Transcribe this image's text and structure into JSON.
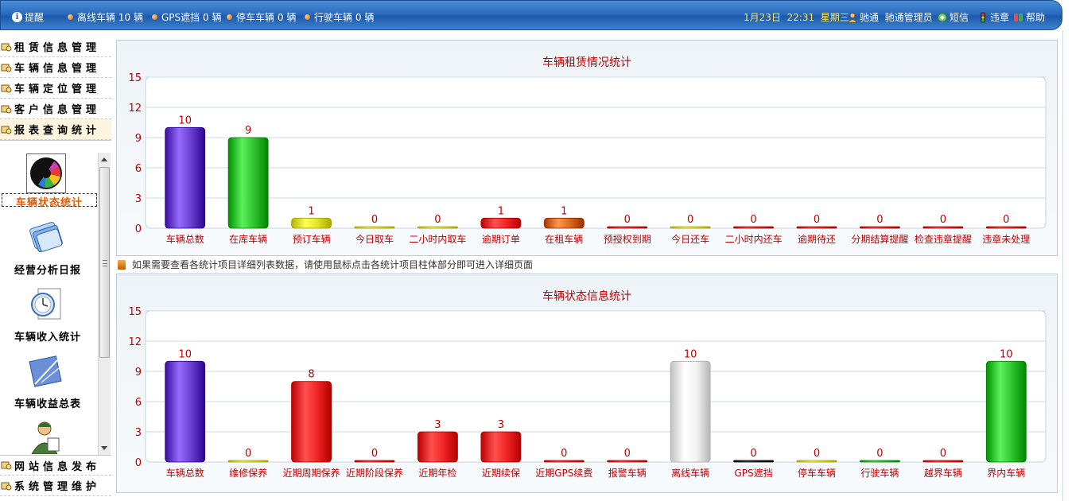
{
  "topbar": {
    "reminder": "提醒",
    "stats": [
      {
        "label": "离线车辆",
        "count": "10",
        "unit": "辆"
      },
      {
        "label": "GPS遮挡",
        "count": "0",
        "unit": "辆"
      },
      {
        "label": "停车车辆",
        "count": "0",
        "unit": "辆"
      },
      {
        "label": "行驶车辆",
        "count": "0",
        "unit": "辆"
      }
    ],
    "date": "1月23日",
    "time": "22:31",
    "weekday": "星期三",
    "user": "驰通",
    "role": "驰通管理员",
    "sms": "短信",
    "violation": "违章",
    "help": "帮助"
  },
  "sidebar": {
    "menu": [
      {
        "label": "租赁信息管理"
      },
      {
        "label": "车辆信息管理"
      },
      {
        "label": "车辆定位管理"
      },
      {
        "label": "客户信息管理"
      },
      {
        "label": "报表查询统计"
      }
    ],
    "tools": [
      {
        "label": "车辆状态统计",
        "icon": "color-wheel-icon"
      },
      {
        "label": "经营分析日报",
        "icon": "document-stack-icon"
      },
      {
        "label": "车辆收入统计",
        "icon": "clock-document-icon"
      },
      {
        "label": "车辆收益总表",
        "icon": "drafting-icon"
      },
      {
        "label": "",
        "icon": "person-icon"
      }
    ],
    "bottom_menu": [
      {
        "label": "网站信息发布"
      },
      {
        "label": "系统管理维护"
      }
    ]
  },
  "hint": "如果需要查看各统计项目详细列表数据，请使用鼠标点击各统计项目柱体部分即可进入详细页面",
  "colors": {
    "purple": "#6a3fd0",
    "green": "#2fc32f",
    "yellow": "#e4e42a",
    "red": "#ef2424",
    "orange": "#d86a1c",
    "white": "#f2f2f2",
    "black": "#222222",
    "axis_text": "#c00000"
  },
  "chart_data": [
    {
      "type": "bar",
      "title": "车辆租赁情况统计",
      "categories": [
        "车辆总数",
        "在库车辆",
        "预订车辆",
        "今日取车",
        "二小时内取车",
        "逾期订单",
        "在租车辆",
        "预授权到期",
        "今日还车",
        "二小时内还车",
        "逾期待还",
        "分期结算提醒",
        "检查违章提醒",
        "违章未处理"
      ],
      "values": [
        10,
        9,
        1,
        0,
        0,
        1,
        1,
        0,
        0,
        0,
        0,
        0,
        0,
        0
      ],
      "bar_colors": [
        "purple",
        "green",
        "yellow",
        "yellow",
        "yellow",
        "red",
        "orange",
        "red",
        "yellow",
        "red",
        "red",
        "red",
        "red",
        "red"
      ],
      "ylim": [
        0,
        15
      ],
      "yticks": [
        0,
        3,
        6,
        9,
        12,
        15
      ],
      "grid": true
    },
    {
      "type": "bar",
      "title": "车辆状态信息统计",
      "categories": [
        "车辆总数",
        "维修保养",
        "近期周期保养",
        "近期阶段保养",
        "近期年检",
        "近期续保",
        "近期GPS续费",
        "报警车辆",
        "离线车辆",
        "GPS遮挡",
        "停车车辆",
        "行驶车辆",
        "越界车辆",
        "界内车辆"
      ],
      "values": [
        10,
        0,
        8,
        0,
        3,
        3,
        0,
        0,
        10,
        0,
        0,
        0,
        0,
        10
      ],
      "bar_colors": [
        "purple",
        "yellow",
        "red",
        "red",
        "red",
        "red",
        "red",
        "red",
        "white",
        "black",
        "yellow",
        "green",
        "red",
        "green"
      ],
      "ylim": [
        0,
        15
      ],
      "yticks": [
        0,
        3,
        6,
        9,
        12,
        15
      ],
      "grid": true
    }
  ]
}
